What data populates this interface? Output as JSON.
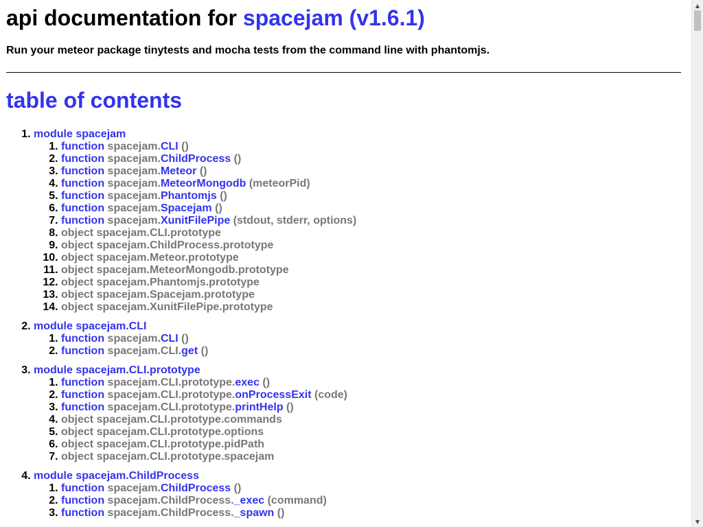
{
  "title": {
    "prefix": "api documentation for ",
    "package_link": "spacejam (v1.6.1)"
  },
  "description": "Run your meteor package tinytests and mocha tests from the command line with phantomjs.",
  "toc_title": "table of contents",
  "colors": {
    "link": "#3333ee",
    "muted": "#777777"
  },
  "modules": [
    {
      "label": "module spacejam",
      "items": [
        {
          "kind": "function",
          "prefix": "spacejam.",
          "name": "CLI",
          "args": "()"
        },
        {
          "kind": "function",
          "prefix": "spacejam.",
          "name": "ChildProcess",
          "args": "()"
        },
        {
          "kind": "function",
          "prefix": "spacejam.",
          "name": "Meteor",
          "args": "()"
        },
        {
          "kind": "function",
          "prefix": "spacejam.",
          "name": "MeteorMongodb",
          "args": "(meteorPid)"
        },
        {
          "kind": "function",
          "prefix": "spacejam.",
          "name": "Phantomjs",
          "args": "()"
        },
        {
          "kind": "function",
          "prefix": "spacejam.",
          "name": "Spacejam",
          "args": "()"
        },
        {
          "kind": "function",
          "prefix": "spacejam.",
          "name": "XunitFilePipe",
          "args": "(stdout, stderr, options)"
        },
        {
          "kind": "object",
          "text": "object spacejam.CLI.prototype"
        },
        {
          "kind": "object",
          "text": "object spacejam.ChildProcess.prototype"
        },
        {
          "kind": "object",
          "text": "object spacejam.Meteor.prototype"
        },
        {
          "kind": "object",
          "text": "object spacejam.MeteorMongodb.prototype"
        },
        {
          "kind": "object",
          "text": "object spacejam.Phantomjs.prototype"
        },
        {
          "kind": "object",
          "text": "object spacejam.Spacejam.prototype"
        },
        {
          "kind": "object",
          "text": "object spacejam.XunitFilePipe.prototype"
        }
      ]
    },
    {
      "label": "module spacejam.CLI",
      "items": [
        {
          "kind": "function",
          "prefix": "spacejam.",
          "name": "CLI",
          "args": "()"
        },
        {
          "kind": "function",
          "prefix": "spacejam.CLI.",
          "name": "get",
          "args": "()"
        }
      ]
    },
    {
      "label": "module spacejam.CLI.prototype",
      "items": [
        {
          "kind": "function",
          "prefix": "spacejam.CLI.prototype.",
          "name": "exec",
          "args": "()"
        },
        {
          "kind": "function",
          "prefix": "spacejam.CLI.prototype.",
          "name": "onProcessExit",
          "args": "(code)"
        },
        {
          "kind": "function",
          "prefix": "spacejam.CLI.prototype.",
          "name": "printHelp",
          "args": "()"
        },
        {
          "kind": "object",
          "text": "object spacejam.CLI.prototype.commands"
        },
        {
          "kind": "object",
          "text": "object spacejam.CLI.prototype.options"
        },
        {
          "kind": "object",
          "text": "object spacejam.CLI.prototype.pidPath"
        },
        {
          "kind": "object",
          "text": "object spacejam.CLI.prototype.spacejam"
        }
      ]
    },
    {
      "label": "module spacejam.ChildProcess",
      "items": [
        {
          "kind": "function",
          "prefix": "spacejam.",
          "name": "ChildProcess",
          "args": "()"
        },
        {
          "kind": "function",
          "prefix": "spacejam.ChildProcess.",
          "name": "_exec",
          "args": "(command)"
        },
        {
          "kind": "function",
          "prefix": "spacejam.ChildProcess.",
          "name": "_spawn",
          "args": "()"
        }
      ]
    }
  ],
  "function_keyword": "function",
  "scrollbar": {
    "up_icon": "scroll-up-arrow-icon",
    "down_icon": "scroll-down-arrow-icon"
  }
}
